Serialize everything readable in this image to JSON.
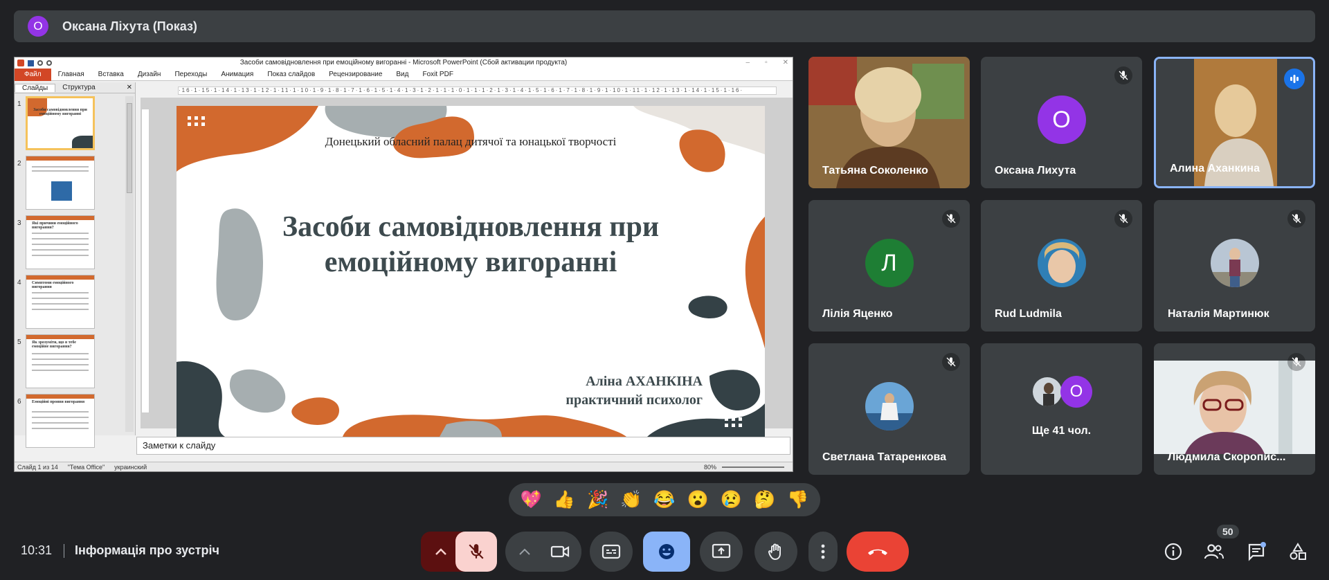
{
  "presenter": {
    "initial": "О",
    "name": "Оксана Ліхута (Показ)"
  },
  "ppt": {
    "window_title": "Засоби самовідновлення при емоційному вигоранні  -  Microsoft PowerPoint (Сбой активации продукта)",
    "tabs": [
      "Файл",
      "Главная",
      "Вставка",
      "Дизайн",
      "Переходы",
      "Анимация",
      "Показ слайдов",
      "Рецензирование",
      "Вид",
      "Foxit PDF"
    ],
    "pane_tabs": [
      "Слайды",
      "Структура"
    ],
    "ruler": "·16·1·15·1·14·1·13·1·12·1·11·1·10·1·9·1·8·1·7·1·6·1·5·1·4·1·3·1·2·1·1·1·0·1·1·1·2·1·3·1·4·1·5·1·6·1·7·1·8·1·9·1·10·1·11·1·12·1·13·1·14·1·15·1·16·",
    "thumbs": [
      {
        "num": "1",
        "title": "Засоби самовідновлення при емоційному вигоранні"
      },
      {
        "num": "2",
        "title": ""
      },
      {
        "num": "3",
        "title": "Які причини емоційного вигорання?"
      },
      {
        "num": "4",
        "title": "Симптоми емоційного вигорання"
      },
      {
        "num": "5",
        "title": "Як зрозуміти, що в тебе емоційне вигорання?"
      },
      {
        "num": "6",
        "title": "Емоційні прояви вигорання"
      }
    ],
    "slide": {
      "subtitle": "Донецький обласний  палац  дитячої та юнацької творчості",
      "heading": "Засоби самовідновлення при емоційному вигоранні",
      "author_name": "Аліна АХАНКІНА",
      "author_role": "практичний психолог"
    },
    "notes_placeholder": "Заметки к слайду",
    "status": {
      "slide_info": "Слайд 1 из 14",
      "theme": "\"Тема Office\"",
      "lang": "украинский",
      "zoom": "80%"
    }
  },
  "tiles": [
    {
      "name": "Татьяна Соколенко"
    },
    {
      "name": "Оксана Лихута",
      "initial": "О",
      "color": "#9334e6"
    },
    {
      "name": "Алина Аханкина"
    },
    {
      "name": "Лілія Яценко",
      "initial": "Л",
      "color": "#1e7e34"
    },
    {
      "name": "Rud Ludmila"
    },
    {
      "name": "Наталія Мартинюк"
    },
    {
      "name": "Светлана Татаренкова"
    },
    {
      "name": "Ще 41 чол.",
      "initial": "О",
      "color": "#9334e6"
    },
    {
      "name": "Людмила Скоропис..."
    }
  ],
  "reactions": [
    "💖",
    "👍",
    "🎉",
    "👏",
    "😂",
    "😮",
    "😢",
    "🤔",
    "👎"
  ],
  "bottom": {
    "time": "10:31",
    "info": "Інформація про зустріч",
    "participants_count": "50"
  },
  "colors": {
    "bg": "#202124",
    "tile": "#3c4043",
    "accent": "#8ab4f8",
    "end_call": "#ea4335",
    "mic_off": "#fad2cf",
    "ppt_orange": "#d2692e"
  }
}
